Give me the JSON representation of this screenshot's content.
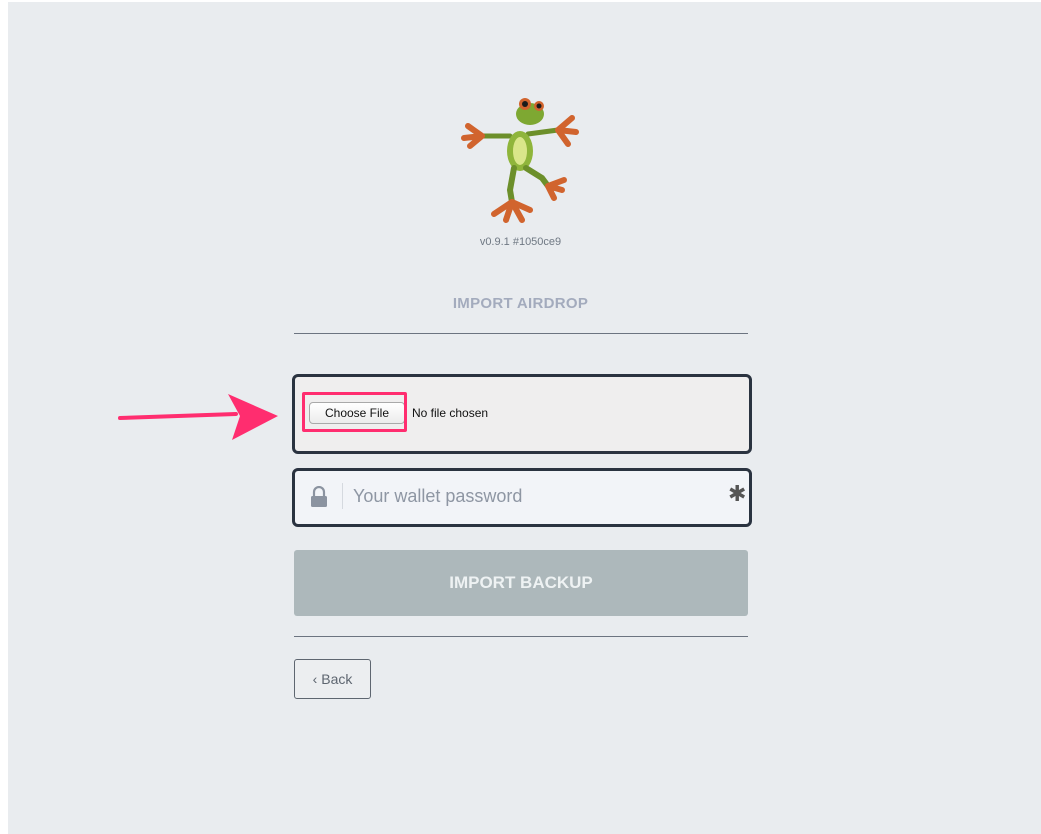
{
  "app": {
    "version": "v0.9.1 #1050ce9",
    "title": "IMPORT AIRDROP"
  },
  "file_input": {
    "button_label": "Choose File",
    "status": "No file chosen"
  },
  "password": {
    "placeholder": "Your wallet password",
    "required_mark": "✱"
  },
  "actions": {
    "import_label": "IMPORT BACKUP",
    "back_label": "Back",
    "back_chevron": "‹"
  },
  "colors": {
    "background": "#e9ecef",
    "highlight": "#ff2d6f",
    "import_button": "#adb8bb",
    "field_border": "#2a3340"
  },
  "icons": {
    "logo": "frog-logo-icon",
    "lock": "lock-icon",
    "arrow": "pointer-arrow-icon"
  }
}
